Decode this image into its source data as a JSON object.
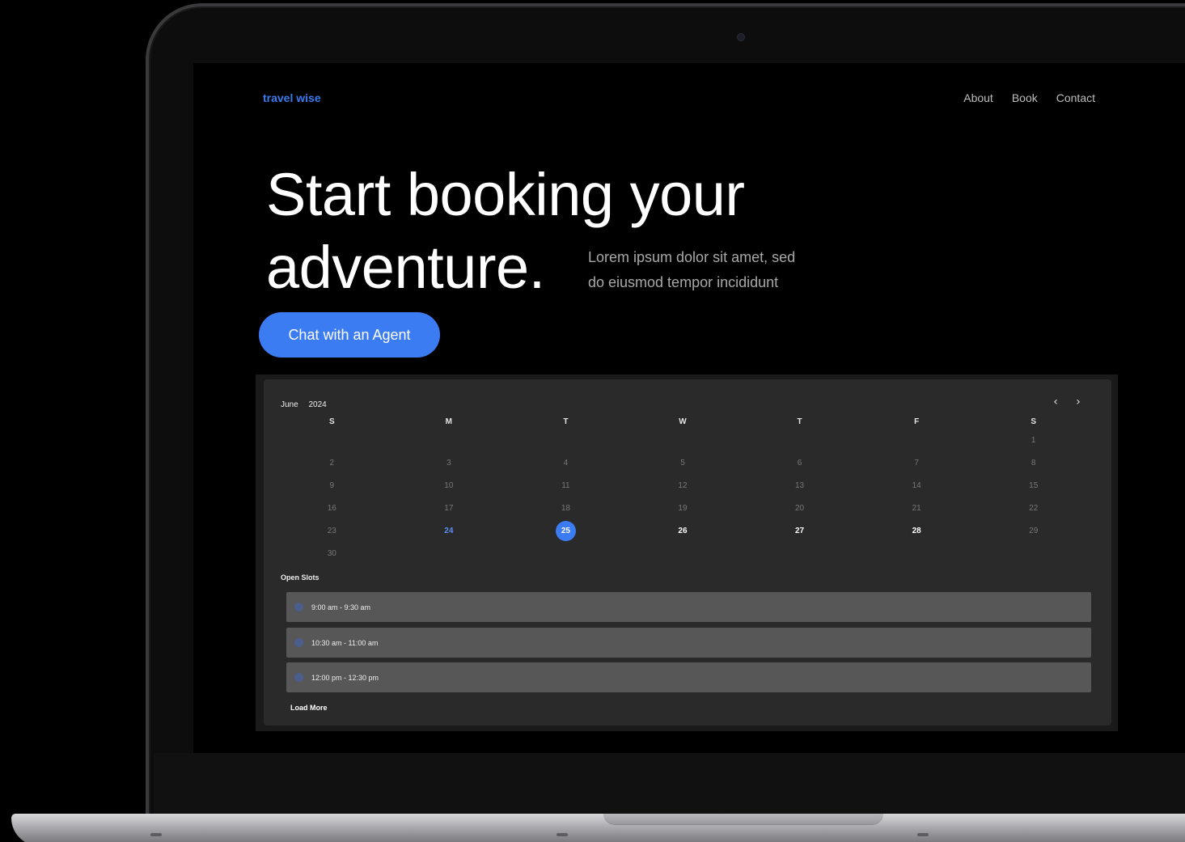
{
  "header": {
    "brand": "travel wise",
    "nav": [
      "About",
      "Book",
      "Contact"
    ]
  },
  "hero": {
    "title_line1": "Start booking your",
    "title_line2": "adventure.",
    "subtitle_line1": "Lorem ipsum dolor sit amet, sed",
    "subtitle_line2": "do eiusmod tempor incididunt",
    "cta_label": "Chat with an Agent"
  },
  "calendar": {
    "month": "June",
    "year": "2024",
    "prev_icon": "chevron-left-icon",
    "next_icon": "chevron-right-icon",
    "weekdays": [
      "S",
      "M",
      "T",
      "W",
      "T",
      "F",
      "S"
    ],
    "weeks": [
      [
        "",
        "",
        "",
        "",
        "",
        "",
        "1"
      ],
      [
        "2",
        "3",
        "4",
        "5",
        "6",
        "7",
        "8"
      ],
      [
        "9",
        "10",
        "11",
        "12",
        "13",
        "14",
        "15"
      ],
      [
        "16",
        "17",
        "18",
        "19",
        "20",
        "21",
        "22"
      ],
      [
        "23",
        "24",
        "25",
        "26",
        "27",
        "28",
        "29"
      ],
      [
        "30",
        "",
        "",
        "",
        "",
        "",
        ""
      ]
    ],
    "today": "24",
    "selected": "25",
    "available": [
      "26",
      "27",
      "28"
    ]
  },
  "slots": {
    "title": "Open Slots",
    "items": [
      "9:00 am - 9:30 am",
      "10:30 am - 11:00 am",
      "12:00 pm - 12:30 pm"
    ],
    "load_more": "Load More"
  },
  "colors": {
    "accent": "#3b7cf3",
    "background": "#000000",
    "panel": "#2a2a2a",
    "slot": "#575757"
  }
}
